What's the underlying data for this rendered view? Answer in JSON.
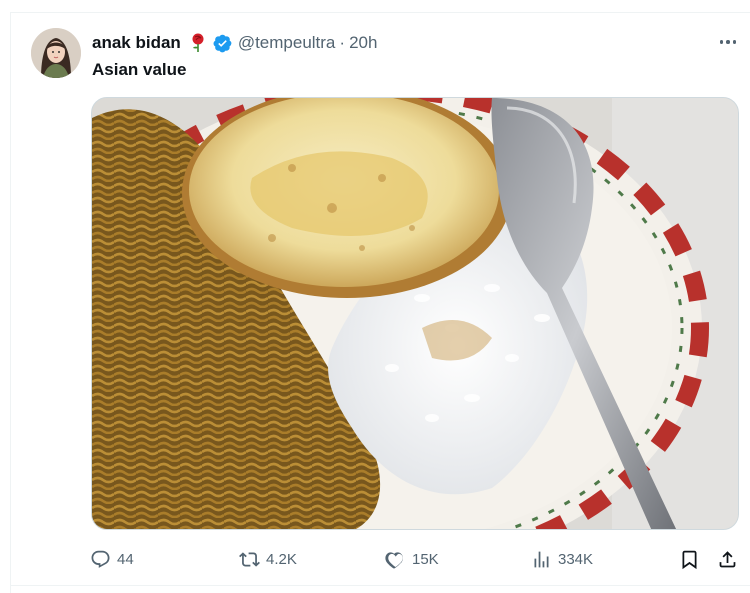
{
  "tweet": {
    "author_name": "anak bidan",
    "author_handle": "@tempeultra",
    "separator": "·",
    "time": "20h",
    "text": "Asian value",
    "emoji_icon": "rose-icon",
    "verified_icon": "verified-badge-icon",
    "media_description_icon": "photo"
  },
  "actions": {
    "replies": "44",
    "reposts": "4.2K",
    "likes": "15K",
    "views": "334K"
  },
  "colors": {
    "text_primary": "#0f1419",
    "text_secondary": "#536471",
    "verified_blue": "#1d9bf0",
    "border": "#cfd9de"
  }
}
